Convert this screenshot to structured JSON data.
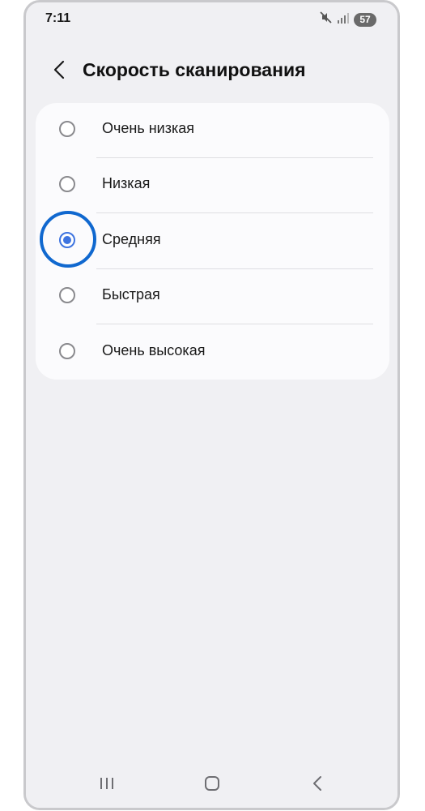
{
  "status_bar": {
    "time": "7:11",
    "battery_level": "57",
    "icons": [
      "mute-icon",
      "signal-icon",
      "battery-icon"
    ]
  },
  "header": {
    "title": "Скорость сканирования",
    "back_icon": "chevron-left-icon"
  },
  "options": [
    {
      "label": "Очень низкая",
      "checked": false
    },
    {
      "label": "Низкая",
      "checked": false
    },
    {
      "label": "Средняя",
      "checked": true
    },
    {
      "label": "Быстрая",
      "checked": false
    },
    {
      "label": "Очень высокая",
      "checked": false
    }
  ],
  "nav_bar": {
    "icons": [
      "recents-icon",
      "home-icon",
      "back-icon"
    ]
  },
  "colors": {
    "accent": "#3e74e0",
    "highlight": "#1068cf",
    "background": "#f0f0f3",
    "card": "#fbfbfd"
  }
}
